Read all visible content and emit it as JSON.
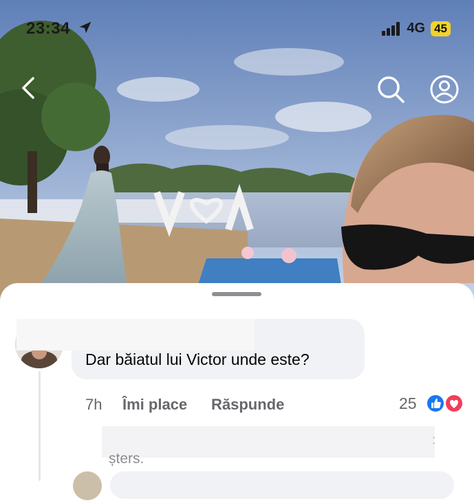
{
  "status_bar": {
    "time": "23:34",
    "network": "4G",
    "battery": "45",
    "location_icon": "location-arrow-icon",
    "signal_icon": "signal-bars-icon"
  },
  "nav": {
    "back_icon": "chevron-left-icon",
    "search_icon": "search-icon",
    "profile_icon": "profile-icon"
  },
  "comment": {
    "text": "Dar băiatul lui Victor unde este?",
    "time": "7h",
    "like_label": "Îmi place",
    "reply_label": "Răspunde",
    "reaction_count": "25",
    "reactions": [
      "like-icon",
      "love-icon"
    ]
  },
  "reply": {
    "status_text": "șters.",
    "separator": ":"
  },
  "colors": {
    "like_blue": "#1877f2",
    "love_red": "#f33e58",
    "meta_gray": "#65676b",
    "bubble_bg": "#f0f2f5"
  }
}
